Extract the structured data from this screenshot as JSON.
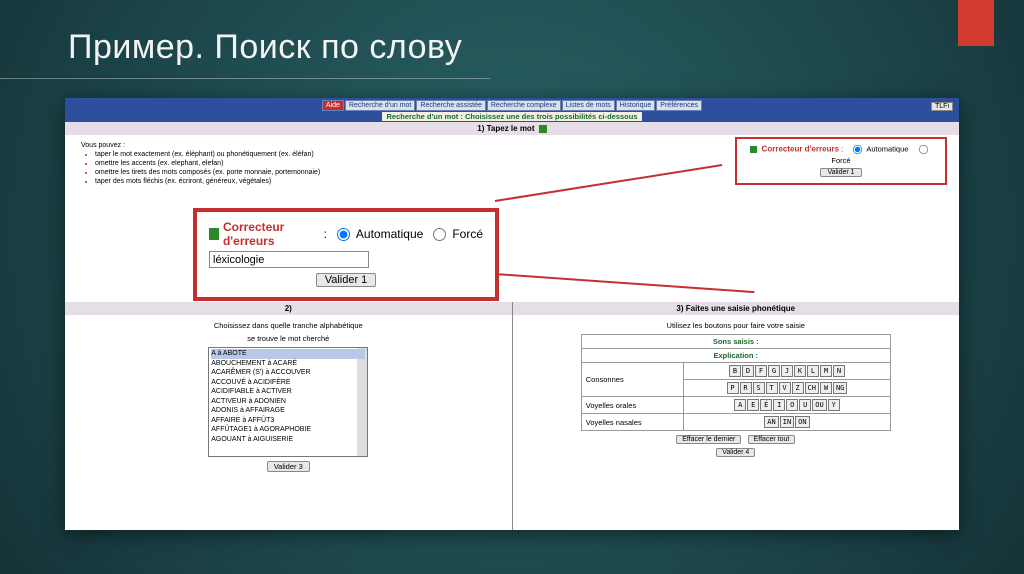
{
  "slide": {
    "title": "Пример. Поиск по слову"
  },
  "nav": [
    "Aide",
    "Recherche d'un mot",
    "Recherche assistée",
    "Recherche complexe",
    "Listes de mots",
    "Historique",
    "Préférences"
  ],
  "subtitle": "Recherche d'un mot : Choisissez une des trois possibilités ci-dessous",
  "tlf_badge": "TLFi",
  "section1": {
    "title": "1) Tapez le mot",
    "hints_intro": "Vous pouvez :",
    "hints": [
      "taper le mot exactement (ex. éléphant) ou phonétiquement (ex. éléfan)",
      "omettre les accents (ex. elephant, elefan)",
      "omettre les tirets des mots composés (ex. porte monnaie, portemonnaie)",
      "taper des mots fléchis (ex. écriront, généreux, végétales)"
    ]
  },
  "corrector": {
    "label": "Correcteur d'erreurs",
    "opt_auto": "Automatique",
    "opt_force": "Forcé",
    "input_value": "léxicologie",
    "btn1": "Valider 1"
  },
  "section2": {
    "title": "2)",
    "instr1": "Choisissez dans quelle tranche alphabétique",
    "instr2": "se trouve le mot cherché",
    "items": [
      "A à ABOTE",
      "ABOUCHEMENT à ACARÉ",
      "ACARÊMER (S') à ACCOUVER",
      "ACCOUVÉ à ACIDIFÈRE",
      "ACIDIFIABLE à ACTIVER",
      "ACTIVEUR à ADONIEN",
      "ADONIS à AFFAIRAGE",
      "AFFAIRE à AFFÛT3",
      "AFFÛTAGE1 à AGORAPHOBIE",
      "AGOUANT à AIGUISERIE"
    ],
    "btn": "Valider 3"
  },
  "section3": {
    "title": "3) Faites une saisie phonétique",
    "instr": "Utilisez les boutons pour faire votre saisie",
    "sons_label": "Sons saisis",
    "expl_label": "Explication",
    "rows": [
      "Consonnes",
      "Voyelles orales",
      "Voyelles nasales"
    ],
    "cons1": [
      "B",
      "D",
      "F",
      "G",
      "J",
      "K",
      "L",
      "M",
      "N"
    ],
    "cons2": [
      "P",
      "R",
      "S",
      "T",
      "V",
      "Z",
      "CH",
      "W",
      "NG"
    ],
    "vo": [
      "A",
      "E",
      "É",
      "I",
      "O",
      "U",
      "OU",
      "Y"
    ],
    "vn": [
      "AN",
      "IN",
      "ON"
    ],
    "btn_del_last": "Effacer le dernier",
    "btn_del_all": "Effacer tout",
    "btn_val": "Valider 4"
  }
}
